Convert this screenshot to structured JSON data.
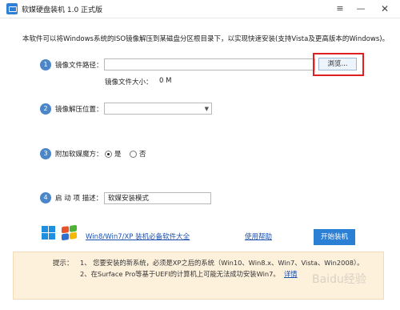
{
  "window": {
    "title": "软媒硬盘装机 1.0 正式版",
    "menu_icon": "≡",
    "minimize_icon": "—",
    "close_icon": "✕"
  },
  "intro_text": "本软件可以将Windows系统的ISO镜像解压到某磁盘分区根目录下，以实现快速安装(支持Vista及更高版本的Windows)。",
  "steps": [
    {
      "number": "1",
      "label": "镜像文件路径：",
      "input_value": "",
      "browse_label": "浏览...",
      "size_label": "镜像文件大小：",
      "size_value": "0 M"
    },
    {
      "number": "2",
      "label": "镜像解压位置：",
      "selected_value": ""
    },
    {
      "number": "3",
      "label": "附加软媒魔方：",
      "options": [
        "是",
        "否"
      ],
      "selected": "是"
    },
    {
      "number": "4",
      "label": "启 动 项 描述：",
      "input_value": "软媒安装模式"
    }
  ],
  "footer": {
    "software_link": "Win8/Win7/XP 装机必备软件大全",
    "help_link": "使用帮助",
    "start_button": "开始装机"
  },
  "tips": {
    "label": "提示：",
    "line1": "1、 您要安装的新系统，必须是XP之后的系统（Win10、Win8.x、Win7、Vista、Win2008）。",
    "line2": "2、在Surface Pro等基于UEFI的计算机上可能无法成功安装Win7。",
    "detail_link": "详情"
  },
  "watermark": "Baidu经验",
  "colors": {
    "accent": "#2b7fd4",
    "step_circle": "#4a86c8",
    "highlight_border": "#e02020",
    "tip_background": "#fdf1dc",
    "link": "#1a4fb0"
  }
}
